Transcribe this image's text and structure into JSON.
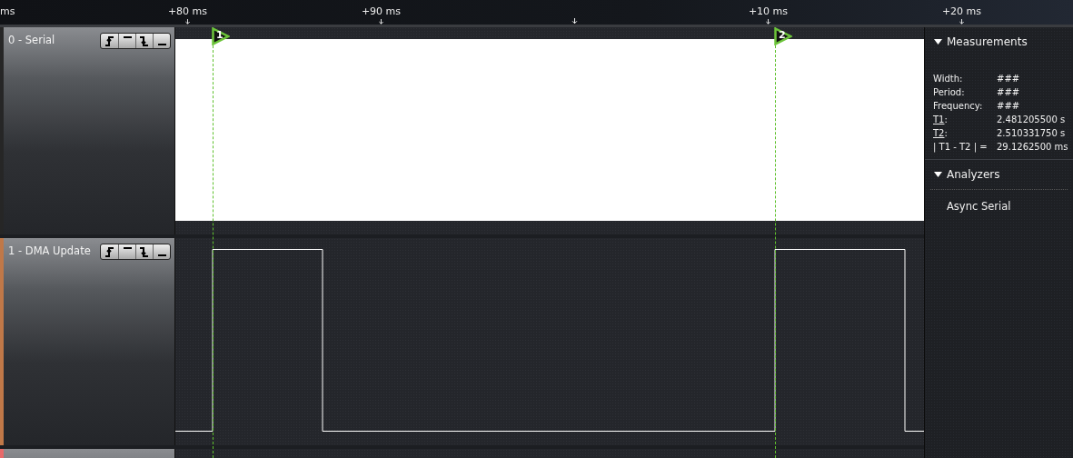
{
  "ruler": {
    "unit_fragment": "ms",
    "ticks": [
      {
        "kind": "labeled",
        "label": "+80 ms"
      },
      {
        "kind": "labeled",
        "label": "+90 ms"
      },
      {
        "kind": "unlabeled"
      },
      {
        "kind": "labeled",
        "label": "+10 ms"
      },
      {
        "kind": "labeled",
        "label": "+20 ms"
      }
    ]
  },
  "cursors": [
    {
      "label": "1"
    },
    {
      "label": "2"
    }
  ],
  "channels": [
    {
      "name": "0 - Serial",
      "color": "#262626",
      "kind": "serial"
    },
    {
      "name": "1 - DMA Update",
      "color": "#c07848",
      "kind": "digital"
    },
    {
      "color": "#e86a6a",
      "kind": "digital"
    }
  ],
  "measurements": {
    "title": "Measurements",
    "expanded": true,
    "rows": [
      {
        "label": "Width:",
        "value": "###",
        "link": false
      },
      {
        "label": "Period:",
        "value": "###",
        "link": false
      },
      {
        "label": "Frequency:",
        "value": "###",
        "link": false
      },
      {
        "label": "T1",
        "suffix": ":",
        "value": "2.481205500 s",
        "link": true
      },
      {
        "label": "T2",
        "suffix": ":",
        "value": "2.510331750 s",
        "link": true
      },
      {
        "label": "| T1 - T2 | =",
        "value": "29.1262500 ms",
        "link": false
      }
    ]
  },
  "analyzers": {
    "title": "Analyzers",
    "expanded": true,
    "items": [
      "Async Serial"
    ]
  }
}
